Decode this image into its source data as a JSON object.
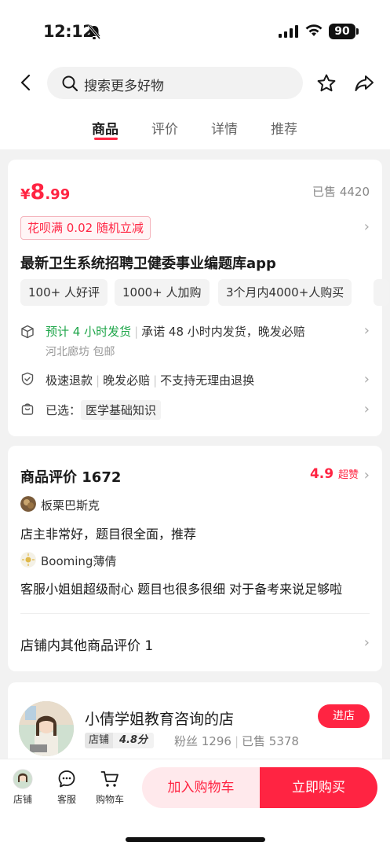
{
  "status": {
    "time": "12:12",
    "battery": "90"
  },
  "nav": {
    "search_placeholder": "搜索更多好物",
    "tabs": [
      "商品",
      "评价",
      "详情",
      "推荐"
    ]
  },
  "product": {
    "price_symbol": "¥",
    "price_int": "8",
    "price_dec": ".99",
    "sold": "已售 4420",
    "promo": "花呗满 0.02 随机立减",
    "title": "最新卫生系统招聘卫健委事业编题库app",
    "chips": [
      "100+ 人好评",
      "1000+ 人加购",
      "3个月内4000+人购买"
    ],
    "shipping_eta": "预计 4 小时发货",
    "shipping_promise": "承诺 48 小时内发货，晚发必赔",
    "shipping_origin": "河北廊坊 包邮",
    "service_1": "极速退款",
    "service_2": "晚发必赔",
    "service_3": "不支持无理由退换",
    "selected_label": "已选：",
    "selected_value": "医学基础知识"
  },
  "reviews": {
    "title": "商品评价 1672",
    "rating": "4.9",
    "rating_tag": "超赞",
    "items": [
      {
        "user": "板栗巴斯克",
        "text": "店主非常好，题目很全面，推荐"
      },
      {
        "user": "Booming薄倩",
        "text": "客服小姐姐超级耐心 题目也很多很细 对于备考来说足够啦"
      }
    ],
    "other": "店铺内其他商品评价 1"
  },
  "shop": {
    "name": "小倩学姐教育咨询的店",
    "badge_label": "店铺",
    "badge_score": "4.8分",
    "fans": "粉丝 1296",
    "sold": "已售 5378",
    "enter": "进店"
  },
  "bottom": {
    "shop": "店铺",
    "service": "客服",
    "cart": "购物车",
    "add_cart": "加入购物车",
    "buy_now": "立即购买"
  },
  "colors": {
    "accent": "#ff2442",
    "green": "#1fa64a"
  }
}
